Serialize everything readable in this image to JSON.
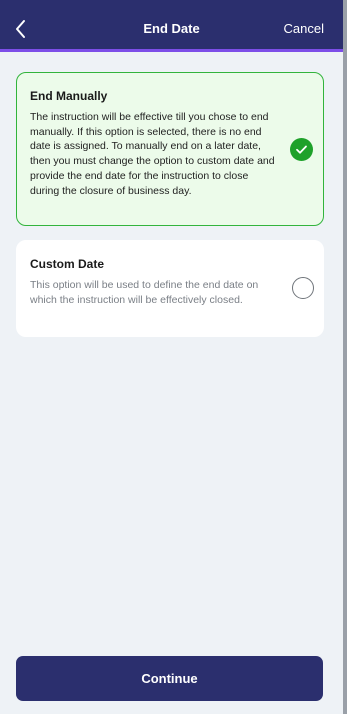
{
  "header": {
    "title": "End Date",
    "cancel_label": "Cancel",
    "back_icon": "chevron-left-icon"
  },
  "options": [
    {
      "title": "End Manually",
      "description": "The instruction will be effective till you chose to end manually. If this option is selected, there is no end date is assigned. To manually end on a later date, then you must change the option to custom date and provide the end date for the instruction to close during the closure of business day.",
      "selected": true
    },
    {
      "title": "Custom Date",
      "description": "This option will be used to define the end date on which the instruction will be effectively closed.",
      "selected": false
    }
  ],
  "footer": {
    "continue_label": "Continue"
  },
  "colors": {
    "header_bg": "#2b2f6e",
    "header_border": "#7d4ee8",
    "selected_card_bg": "#ecfbea",
    "selected_card_border": "#32b43c",
    "check_green": "#1ea12a",
    "page_bg": "#eef2f6"
  }
}
